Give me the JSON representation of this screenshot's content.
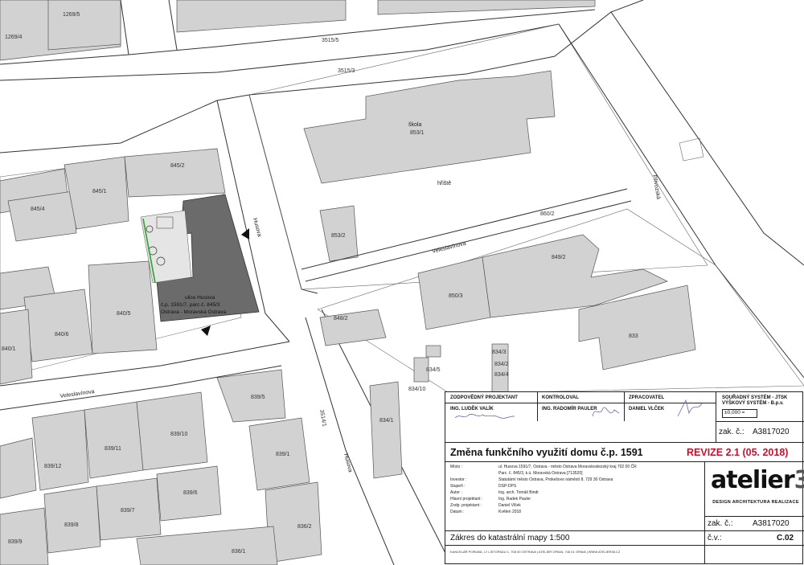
{
  "map": {
    "parcels": {
      "p1269_4": "1269/4",
      "p1269_5": "1269/5",
      "p3515_5": "3515/5",
      "p3515_3": "3515/3",
      "p845_2": "845/2",
      "p845_1": "845/1",
      "p845_4": "845/4",
      "p840_5": "840/5",
      "p840_6": "840/6",
      "p840_1": "840/1",
      "p853_1": "853/1",
      "p853_2": "853/2",
      "p860_2": "860/2",
      "p849_2": "849/2",
      "p850_3": "850/3",
      "p848_2": "848/2",
      "p833": "833",
      "p834_1": "834/1",
      "p834_3": "834/3",
      "p834_10": "834/10",
      "p834_5": "834/5",
      "p834_4": "834/4",
      "p834_2": "834/2",
      "p839_5": "839/5",
      "p839_6": "839/6",
      "p839_10": "839/10",
      "p839_11": "839/11",
      "p839_12": "839/12",
      "p839_1": "839/1",
      "p839_7": "839/7",
      "p839_8": "839/8",
      "p839_9": "839/9",
      "p836_2": "836/2",
      "p836_1": "836/1",
      "p3514_1": "3514/1"
    },
    "labels": {
      "skola": "škola",
      "hriste": "hřiště",
      "street_husova_1": "Husova",
      "street_husova_2": "Husova",
      "street_veleslavinova_1": "Veleslavínova",
      "street_veleslavinova_2": "Veleslavínova",
      "street_privozska": "Přívozská"
    },
    "subject": {
      "line1": "ulice Husova",
      "line2": "č.p. 1591/7, parc.č. 845/3",
      "line3": "Ostrava - Moravská Ostrava"
    }
  },
  "titleblock": {
    "responsible_label": "ZODPOVĚDNÝ PROJEKTANT",
    "responsible_name": "ING. LUDĚK VALÍK",
    "checked_label": "KONTROLOVAL",
    "checked_name": "ING. RADOMÍR PAULER",
    "drawn_label": "ZPRACOVATEL",
    "drawn_name": "DANIEL VLČEK",
    "coord_line1": "SOUŘADNÝ SYSTÉM - JTSK",
    "coord_line2": "VÝŠKOVÝ SYSTÉM - B.p.v.",
    "level": "±0,000 =",
    "zak_label_1": "zak. č.:",
    "zak_value_1": "A3817020",
    "title": "Změna funkčního využití domu č.p. 1591",
    "revision": "REVIZE 2.1 (05. 2018)",
    "rows": [
      {
        "label": "Místo :",
        "value": "ul. Husova 1591/7, Ostrava - město Ostrava Moravskoslezský kraj 702 00 ČR"
      },
      {
        "label": "",
        "value": "Parc. č. 845/3, k.ú. Moravská Ostrava [713520]"
      },
      {
        "label": "Investor :",
        "value": "Statutární město Ostrava, Prokešovo náměstí 8, 729 30 Ostrava"
      },
      {
        "label": "Stupeň :",
        "value": "DSP-DPS"
      },
      {
        "label": "Autor :",
        "value": "Ing. arch. Tomáš Bindr"
      },
      {
        "label": "Hlavní projektant :",
        "value": "Ing. Radek Pauler"
      },
      {
        "label": "Zodp. projektant :",
        "value": "Daniel Vlček"
      },
      {
        "label": "Datum :",
        "value": "Květen 2018"
      }
    ],
    "logo_text": "atelier",
    "logo_num": "38",
    "logo_sub": "DESIGN ARCHITEKTURA REALIZACE",
    "zak_label_2": "zak. č.:",
    "zak_value_2": "A3817020",
    "cv_label": "č.v.:",
    "cv_value": "C.02",
    "drawing_name": "Zákres do katastrální mapy 1:500",
    "footer": "KANCELÁŘ PORUBÁ, 17.LISTOPADU 1, 708 00 OSTRAVA   |   ATELIER OPAVA, 746 01 OPAVA   |   WWW.ATELIER38.CZ"
  }
}
